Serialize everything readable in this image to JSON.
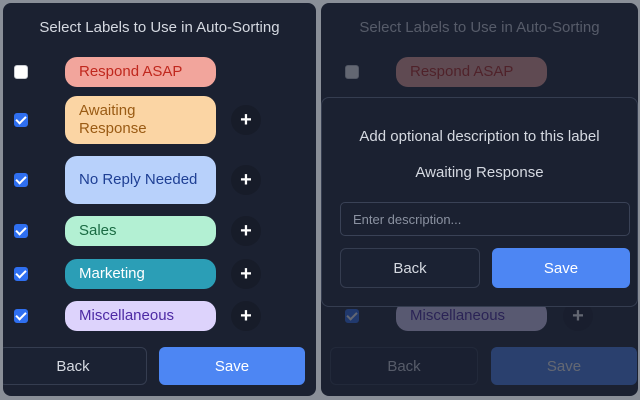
{
  "colors": {
    "panel_bg": "#1b2131",
    "accent": "#4d86f3",
    "checkbox_checked": "#2f6ff0"
  },
  "label_picker": {
    "title": "Select Labels to Use in Auto-Sorting",
    "labels": [
      {
        "name": "Respond ASAP",
        "checked": false,
        "has_add": false,
        "bg": "#f2a59c",
        "fg": "#c0281e"
      },
      {
        "name": "Awaiting Response",
        "checked": true,
        "has_add": true,
        "bg": "#fbd5a4",
        "fg": "#9a5b14"
      },
      {
        "name": "No Reply Needed",
        "checked": true,
        "has_add": true,
        "bg": "#b8d1fb",
        "fg": "#1e3f94"
      },
      {
        "name": "Sales",
        "checked": true,
        "has_add": true,
        "bg": "#b3f0d3",
        "fg": "#1a6b43"
      },
      {
        "name": "Marketing",
        "checked": true,
        "has_add": true,
        "bg": "#2b9eb6",
        "fg": "#ffffff"
      },
      {
        "name": "Miscellaneous",
        "checked": true,
        "has_add": true,
        "bg": "#ddd3fc",
        "fg": "#4d2aa4"
      }
    ],
    "add_symbol": "+",
    "back_label": "Back",
    "save_label": "Save"
  },
  "description_modal": {
    "title": "Add optional description to this label",
    "label_name": "Awaiting Response",
    "input_placeholder": "Enter description...",
    "input_value": "",
    "back_label": "Back",
    "save_label": "Save"
  }
}
